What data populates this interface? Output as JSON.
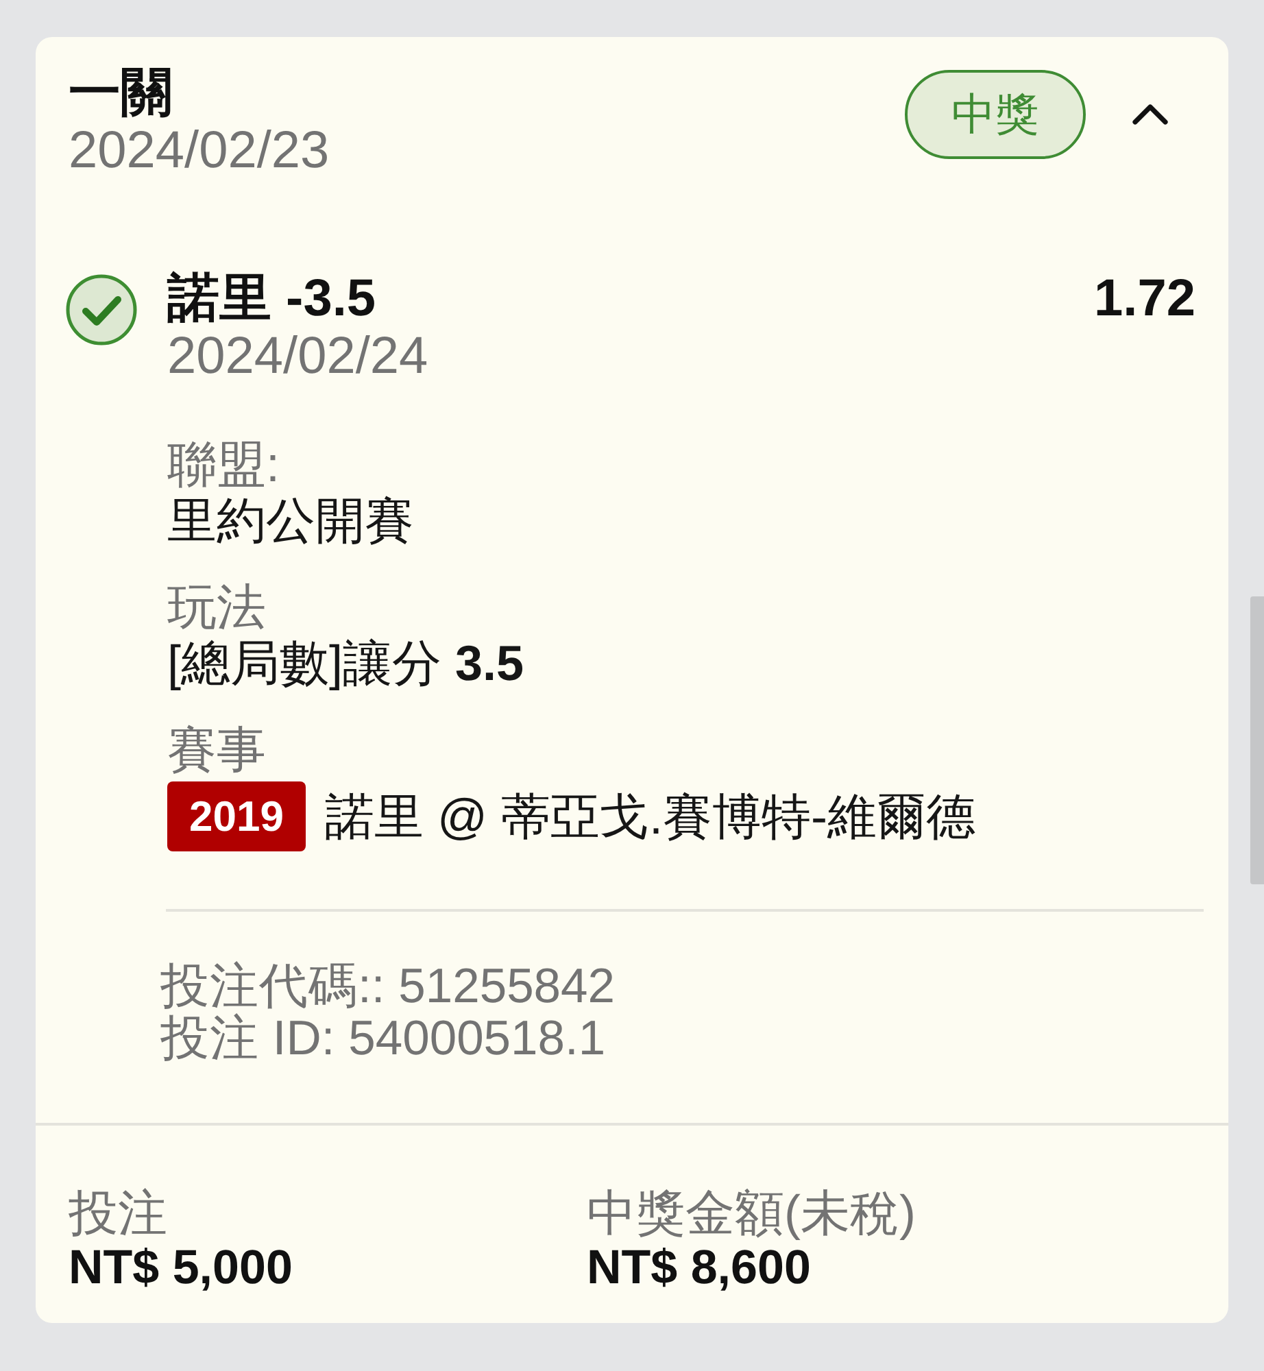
{
  "bet": {
    "title": "一關",
    "date": "2024/02/23",
    "status": "中獎",
    "expanded": true
  },
  "selection": {
    "won": true,
    "pick": "諾里 -3.5",
    "odds": "1.72",
    "date": "2024/02/24",
    "details": [
      {
        "label": "聯盟:",
        "value": "里約公開賽"
      },
      {
        "label": "玩法",
        "value": "[總局數]讓分 **3.5**"
      },
      {
        "label": "賽事",
        "tag": "2019",
        "value": "諾里 @ 蒂亞戈.賽博特-維爾德"
      }
    ]
  },
  "references": [
    "投注代碼:: 51255842",
    "投注 ID: 54000518.1"
  ],
  "summary": [
    {
      "label": "投注",
      "amount": "NT$ 5,000"
    },
    {
      "label": "中獎金額(未稅)",
      "amount": "NT$ 8,600"
    }
  ]
}
